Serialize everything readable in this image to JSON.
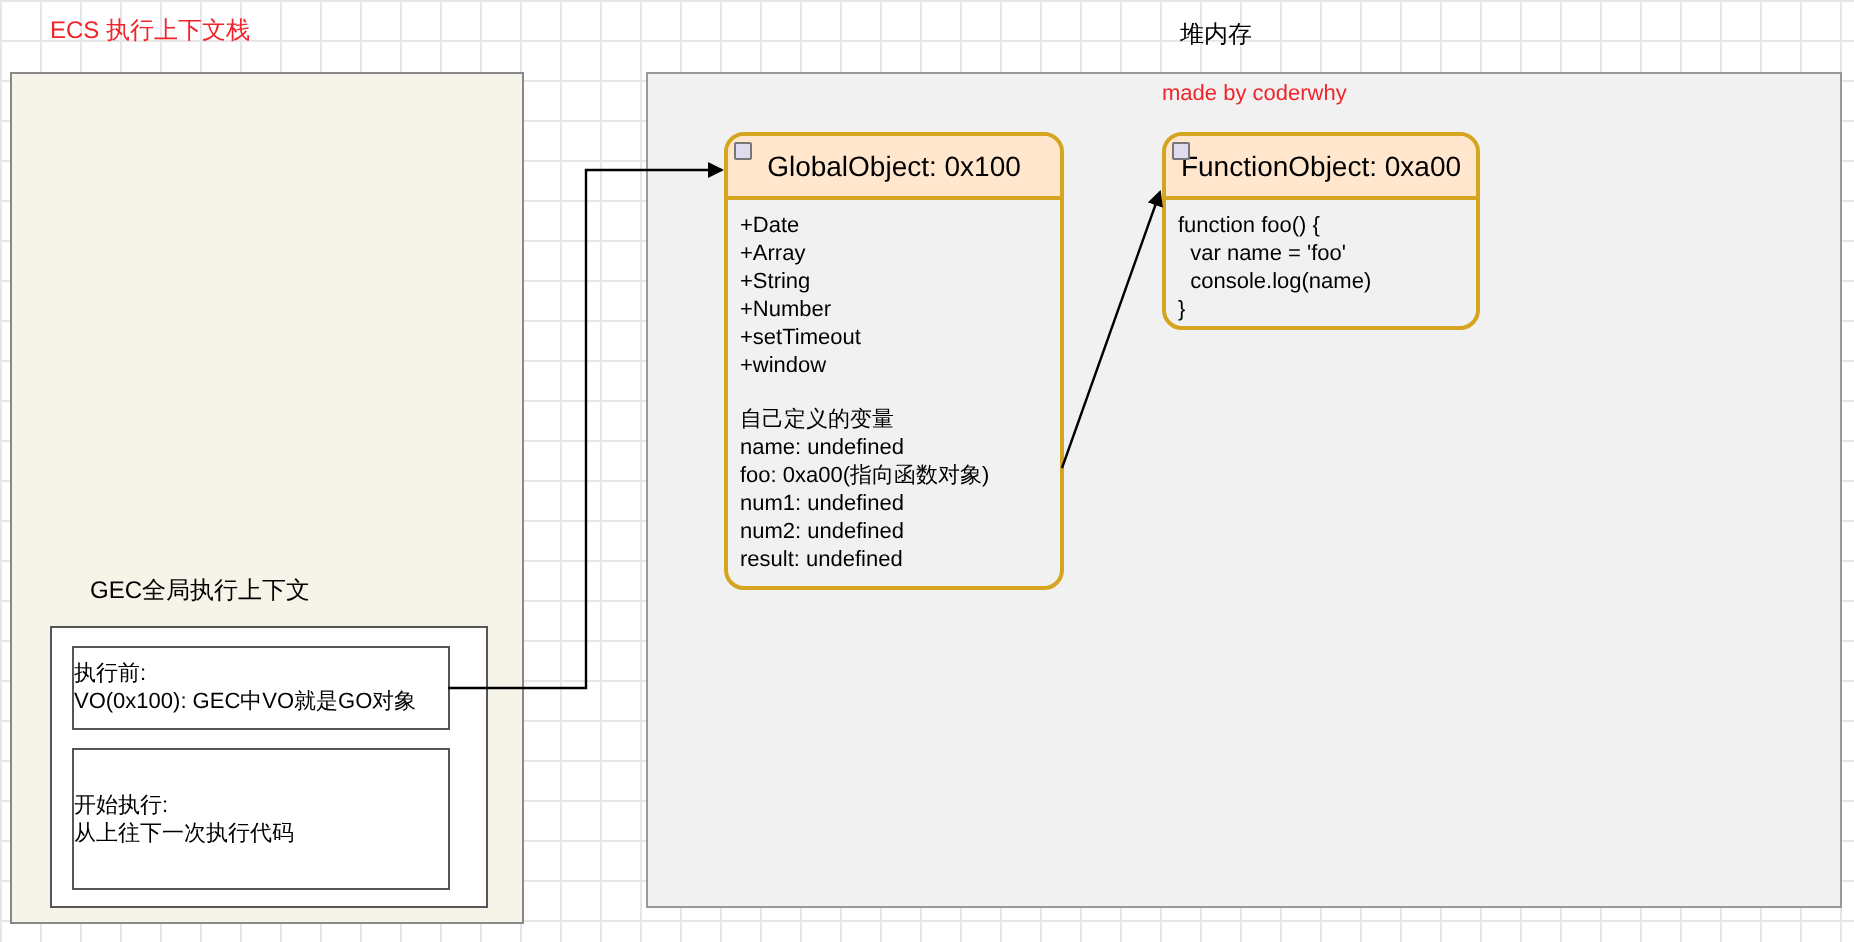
{
  "stack": {
    "title": "ECS 执行上下文栈",
    "context": {
      "title": "GEC全局执行上下文",
      "boxes": [
        {
          "lines": [
            "执行前:",
            "VO(0x100): GEC中VO就是GO对象"
          ]
        },
        {
          "lines": [
            "开始执行:",
            "从上往下一次执行代码"
          ]
        }
      ]
    }
  },
  "heap": {
    "title": "堆内存",
    "credit": "made by coderwhy",
    "objects": [
      {
        "title": "GlobalObject: 0x100",
        "sections": [
          [
            "+Date",
            "+Array",
            "+String",
            "+Number",
            "+setTimeout",
            "+window"
          ],
          [
            "自己定义的变量",
            "name: undefined",
            "foo: 0xa00(指向函数对象)",
            "num1: undefined",
            "num2: undefined",
            "result: undefined"
          ]
        ]
      },
      {
        "title": "FunctionObject: 0xa00",
        "sections": [
          [
            "function foo() {",
            "  var name = 'foo'",
            "  console.log(name)",
            "}"
          ]
        ]
      }
    ]
  }
}
